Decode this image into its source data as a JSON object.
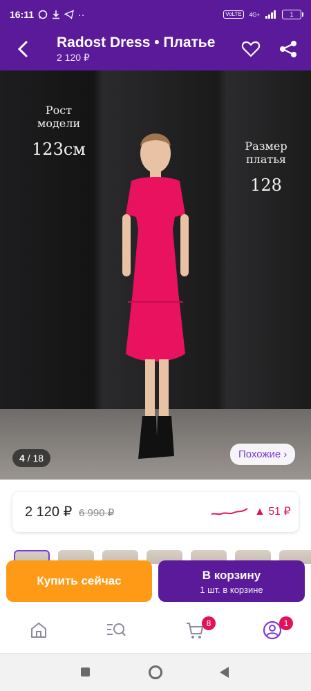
{
  "status_bar": {
    "time": "16:11",
    "network_badge": "VoLTE",
    "network_type": "4G+",
    "battery": "1"
  },
  "header": {
    "title": "Radost Dress • Платье",
    "price": "2 120 ₽"
  },
  "photo": {
    "overlay_height_label": "Рост модели",
    "overlay_height_value": "123см",
    "overlay_size_label": "Размер платья",
    "overlay_size_value": "128",
    "counter_current": "4",
    "counter_total": "/ 18",
    "similar_button": "Похожие ›"
  },
  "price_card": {
    "current_price": "2 120 ₽",
    "old_price": "6 990 ₽",
    "change": "▲ 51 ₽"
  },
  "actions": {
    "buy_now": "Купить сейчас",
    "add_to_cart": "В корзину",
    "cart_status": "1 шт. в корзине"
  },
  "bottom_nav": {
    "cart_badge": "8",
    "profile_badge": "1"
  },
  "colors": {
    "brand": "#5a1a9a",
    "buy_button": "#ff9a16",
    "accent": "#e0125c",
    "dress": "#e8125e"
  }
}
